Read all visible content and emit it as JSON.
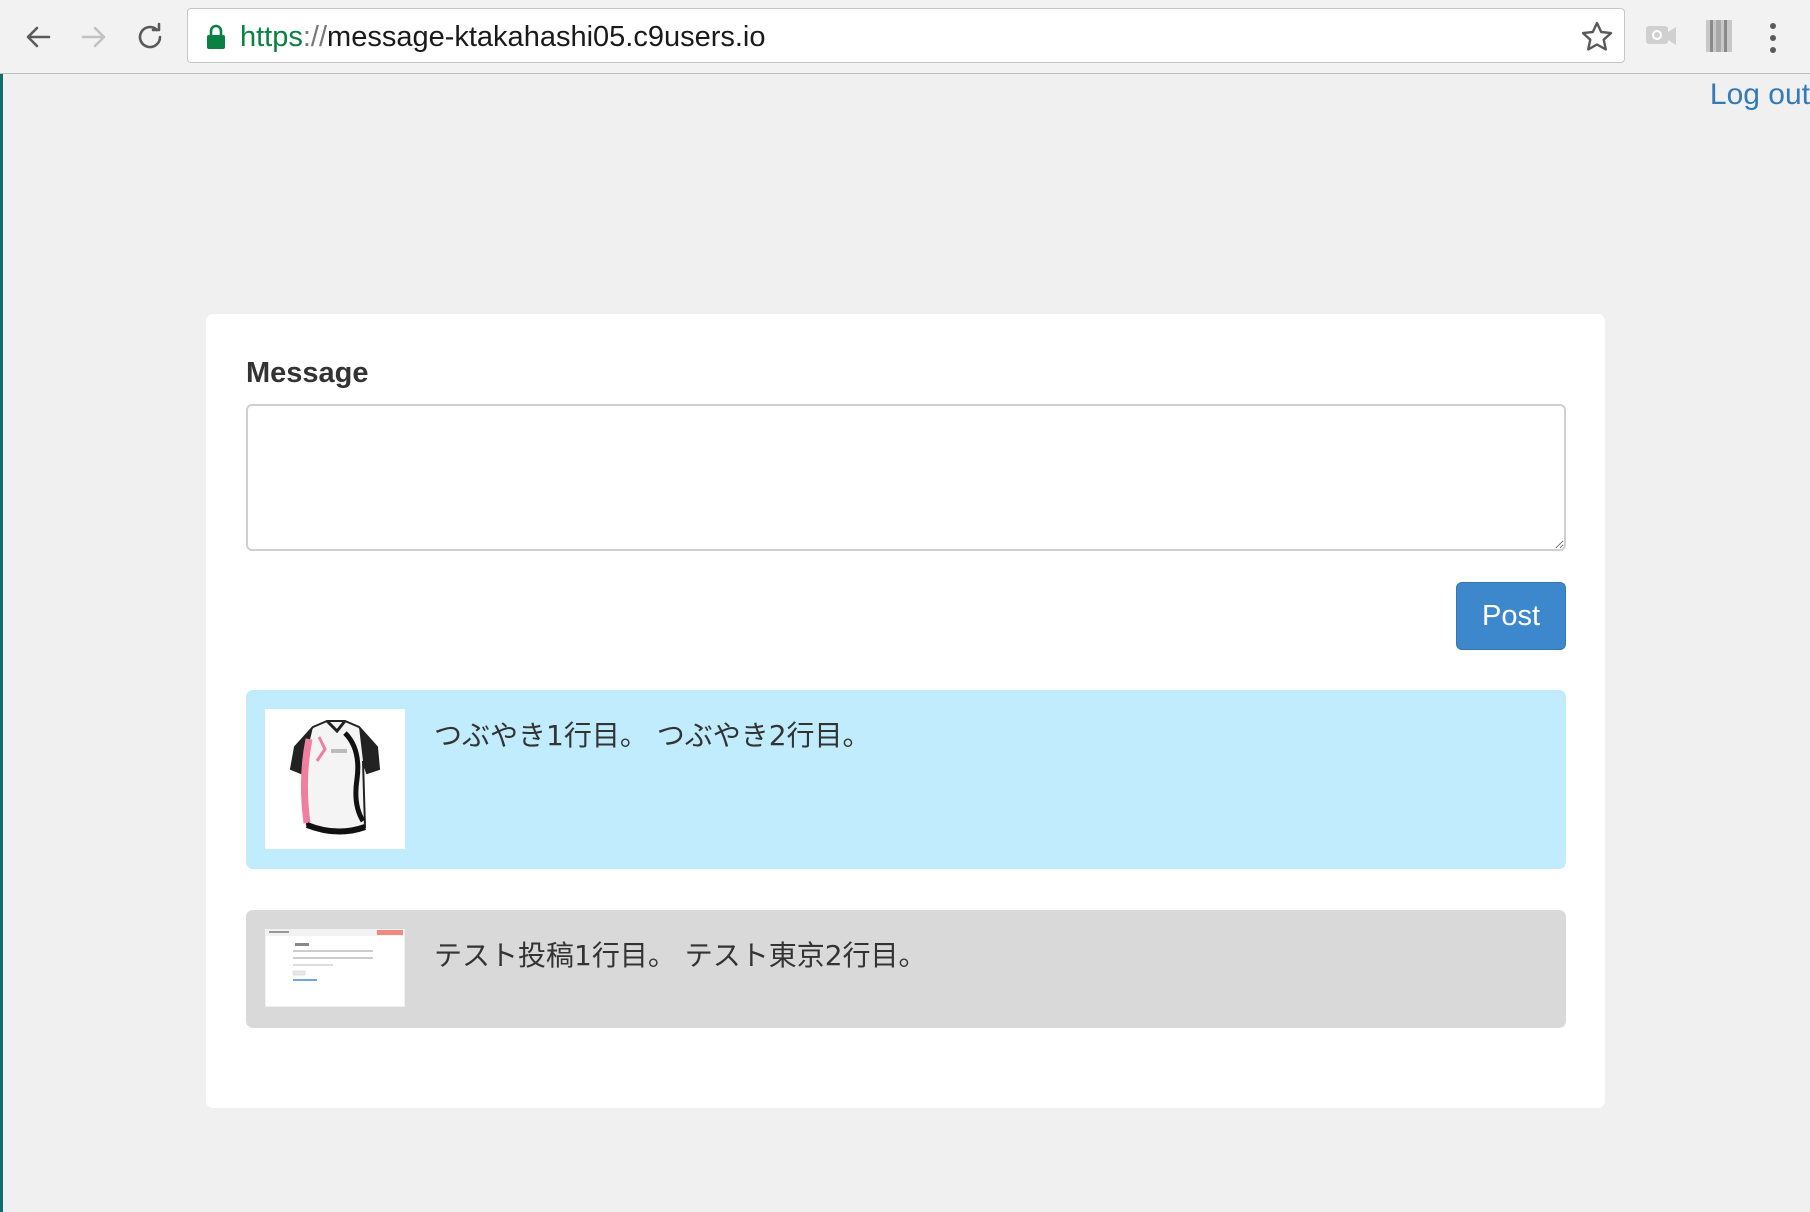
{
  "browser": {
    "url_scheme": "https",
    "url_separator": "://",
    "url_host": "message-ktakahashi05.c9users.io"
  },
  "header": {
    "logout_label": "Log out"
  },
  "form": {
    "message_label": "Message",
    "message_value": "",
    "post_label": "Post"
  },
  "posts": [
    {
      "text": "つぶやき1行目。 つぶやき2行目。",
      "background": "#c0ecfe",
      "thumbnail": "jersey-image"
    },
    {
      "text": "テスト投稿1行目。 テスト東京2行目。",
      "background": "#d9d9d9",
      "thumbnail": "screenshot-image"
    }
  ],
  "colors": {
    "link": "#337ab7",
    "primary_button": "#3d88cc",
    "secure_scheme": "#0b8043"
  }
}
